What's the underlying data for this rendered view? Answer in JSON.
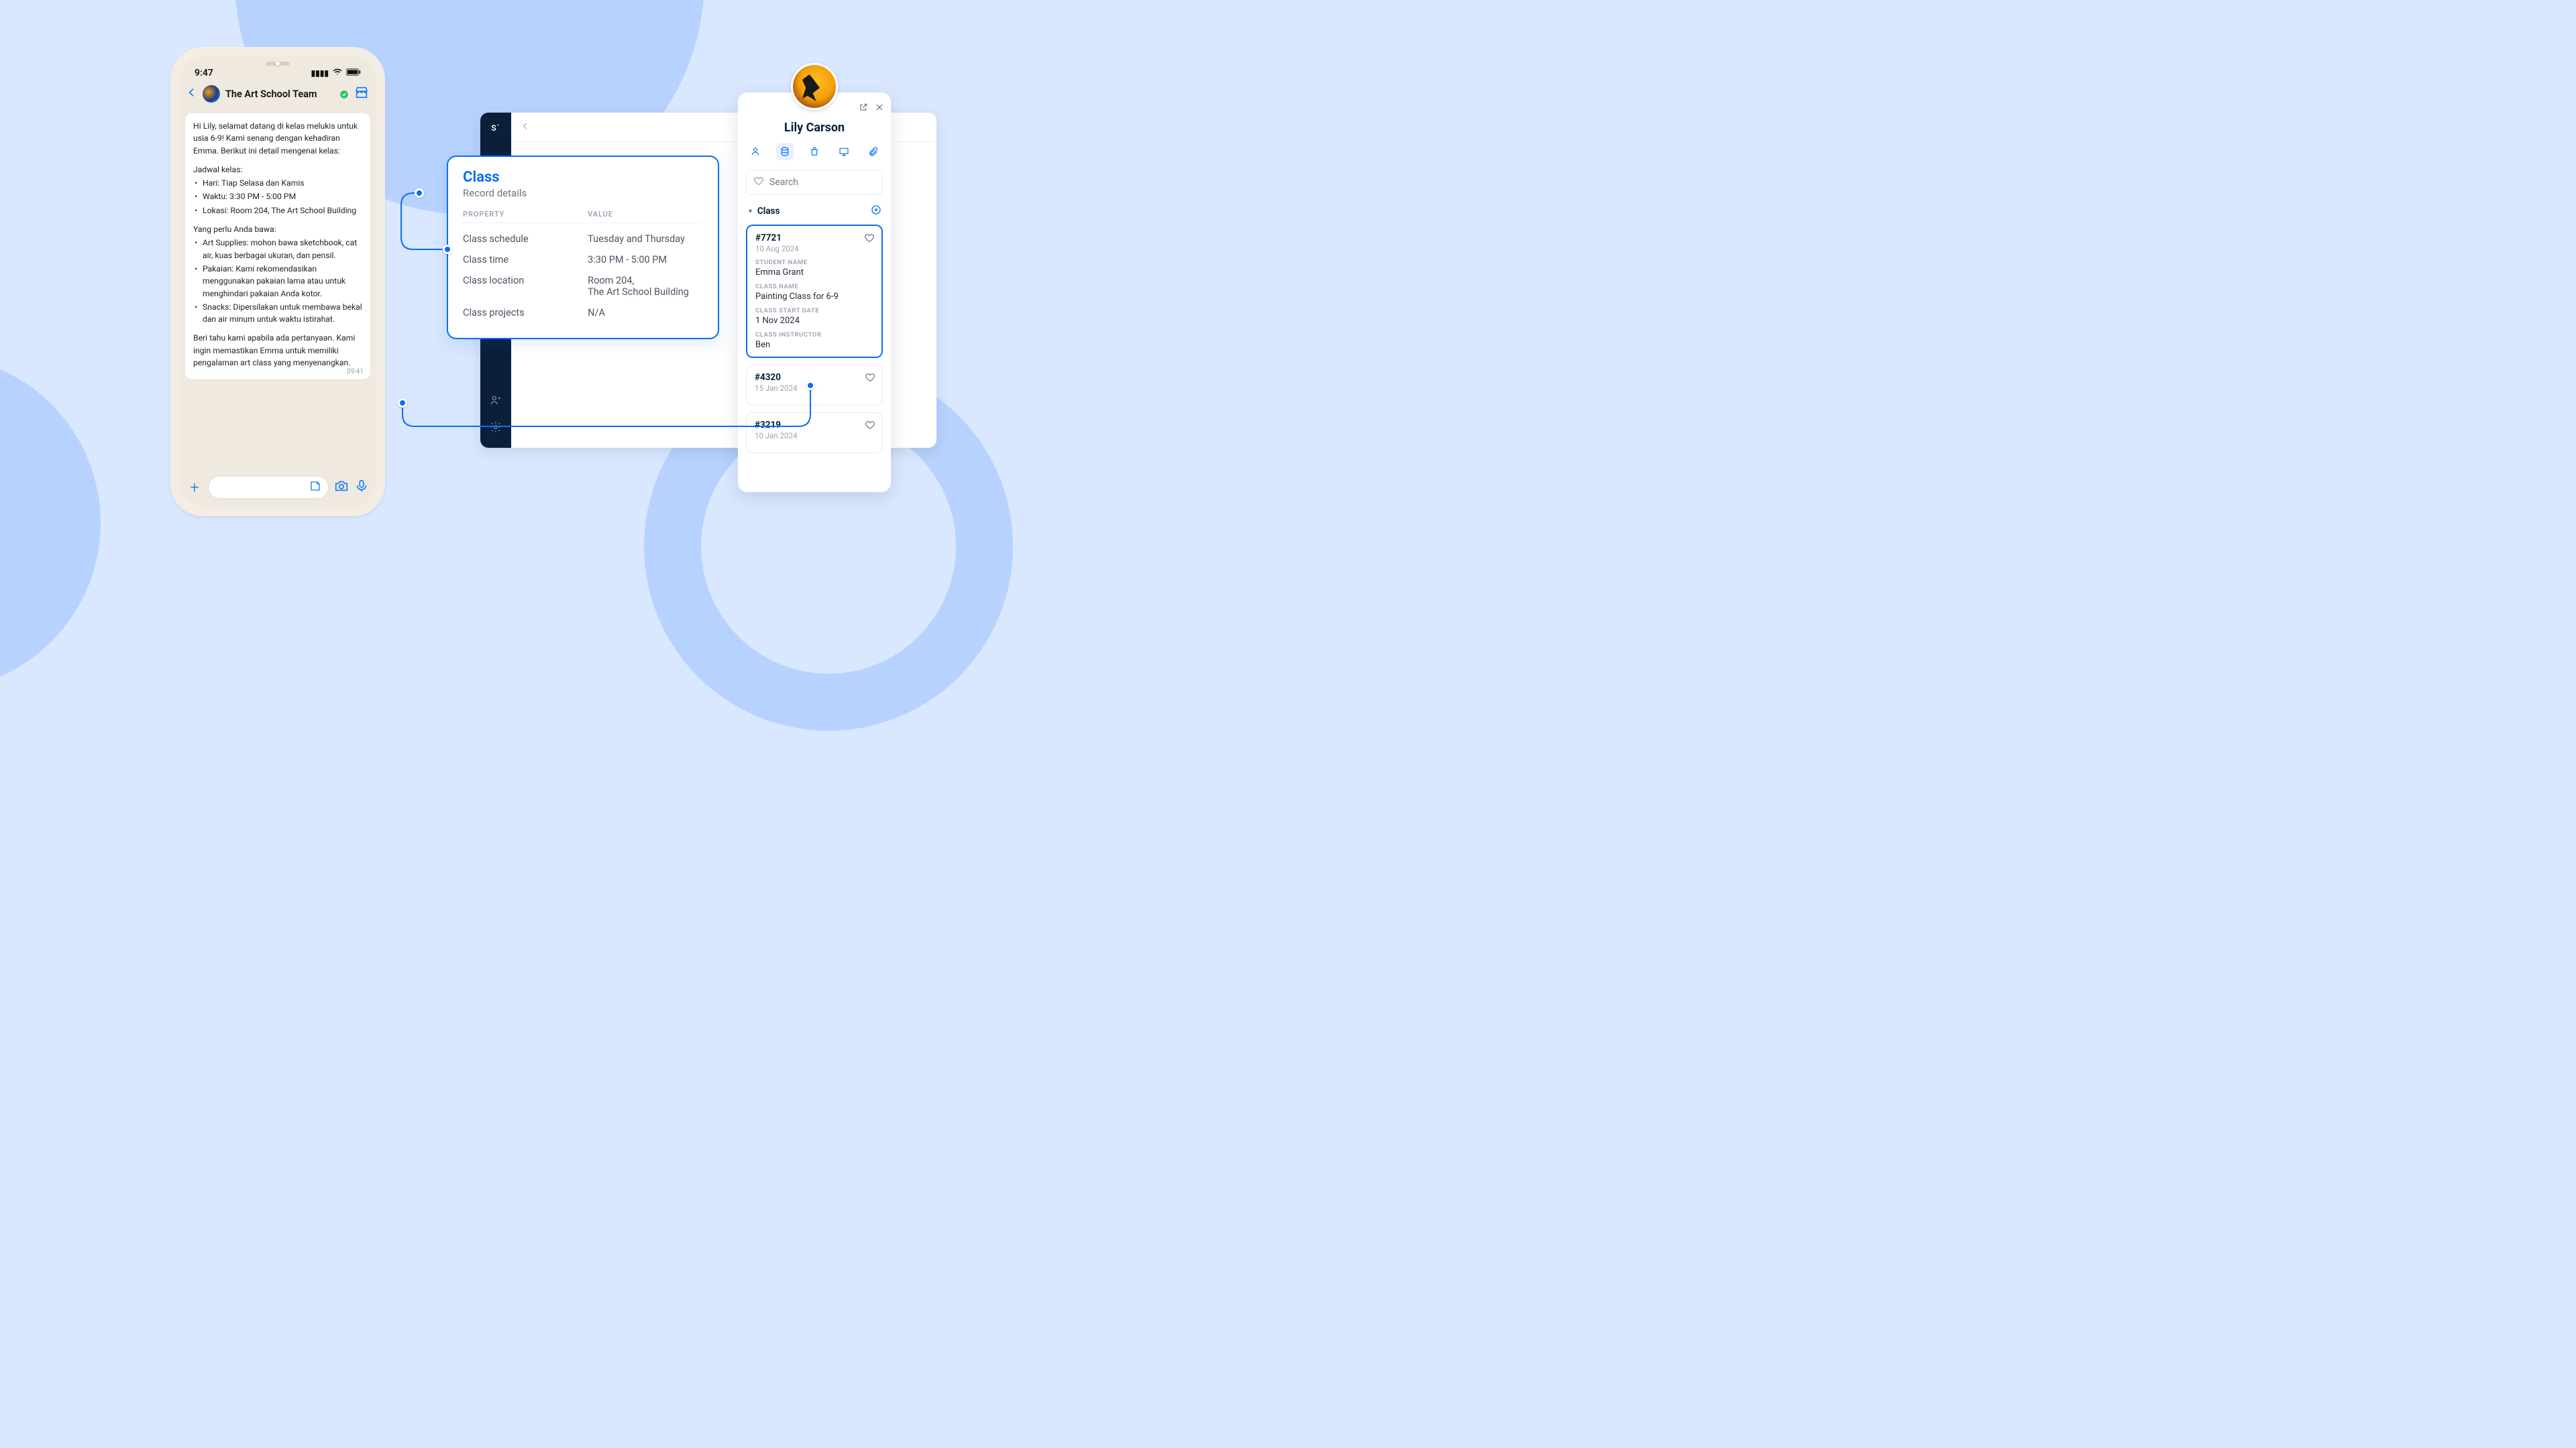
{
  "phone": {
    "time": "9:47",
    "chat_name": "The Art School Team",
    "message": {
      "greeting": "Hi Lily, selamat datang di kelas melukis untuk usia 6-9! Kami senang dengan kehadiran Emma. Berikut ini detail mengenai kelas:",
      "schedule_title": "Jadwal kelas:",
      "schedule": {
        "hari": "Hari: Tiap Selasa dan Kamis",
        "waktu": "Waktu: 3:30 PM - 5:00 PM",
        "lokasi": "Lokasi: Room 204, The Art School Building"
      },
      "bring_title": "Yang perlu Anda bawa:",
      "bring": {
        "supplies": "Art Supplies: mohon bawa sketchbook, cat air, kuas berbagai ukuran, dan pensil.",
        "pakaian": "Pakaian: Kami rekomendasikan menggunakan pakaian lama atau untuk menghindari pakaian Anda kotor.",
        "snacks": "Snacks: Dipersilakan untuk membawa bekal dan air minum untuk waktu istirahat."
      },
      "closing": "Beri tahu kami apabila ada pertanyaan. Kami ingin memastikan Emma untuk memiliki pengalaman art class yang menyenangkan.",
      "timestamp": "09:41"
    }
  },
  "record": {
    "title": "Class",
    "subtitle": "Record details",
    "header_property": "PROPERTY",
    "header_value": "VALUE",
    "rows": {
      "schedule_k": "Class schedule",
      "schedule_v": "Tuesday and Thursday",
      "time_k": "Class time",
      "time_v": "3:30 PM - 5:00 PM",
      "location_k": "Class location",
      "location_v1": "Room 204,",
      "location_v2": "The Art School Building",
      "projects_k": "Class projects",
      "projects_v": "N/A"
    }
  },
  "panel": {
    "name": "Lily Carson",
    "search_placeholder": "Search",
    "section_label": "Class",
    "cards": [
      {
        "id": "#7721",
        "date": "10 Aug 2024",
        "student_label": "STUDENT NAME",
        "student": "Emma Grant",
        "classname_label": "CLASS NAME",
        "classname": "Painting Class for 6-9",
        "start_label": "CLASS START DATE",
        "start": "1 Nov 2024",
        "instructor_label": "CLASS INSTRUCTOR",
        "instructor": "Ben"
      },
      {
        "id": "#4320",
        "date": "15 Jan 2024"
      },
      {
        "id": "#3219",
        "date": "10 Jan 2024"
      }
    ]
  }
}
